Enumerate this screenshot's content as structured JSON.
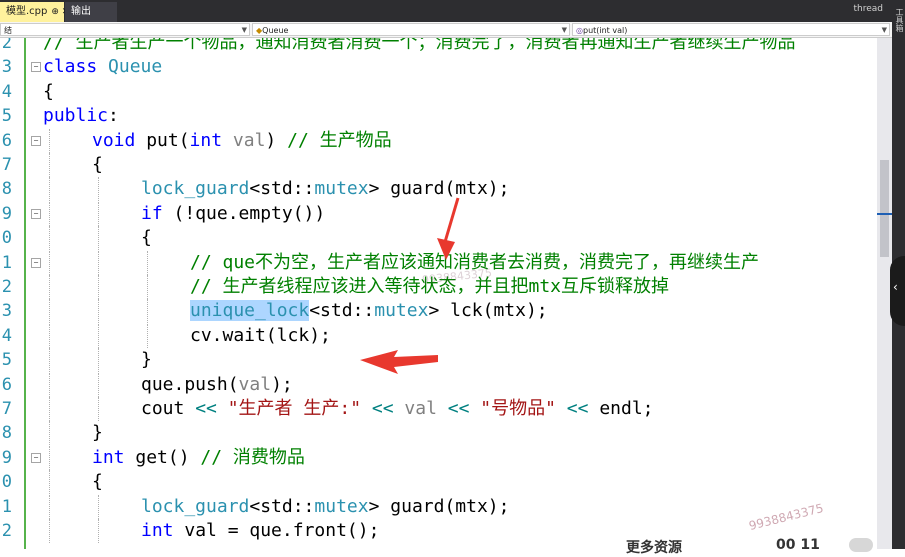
{
  "tabs": [
    {
      "label": "模型.cpp",
      "pin": "⊕ ✕",
      "active": true
    },
    {
      "label": "输出",
      "active": false
    }
  ],
  "tabbar_right": "thread",
  "nav": {
    "scope": "结",
    "class": "Queue",
    "member": "put(int val)"
  },
  "toolstrip_label": "工具箱",
  "code_lines": [
    {
      "num": "2",
      "indent": 0,
      "segments": [
        {
          "t": "// 生产者生产一个物品，通知消费者消费一个；消费完了，消费者再通知生产者继续生产物品",
          "c": "#008000"
        }
      ],
      "fold": ""
    },
    {
      "num": "3",
      "indent": 0,
      "segments": [
        {
          "t": "class ",
          "c": "#0000ff"
        },
        {
          "t": "Queue",
          "c": "#2b91af"
        }
      ],
      "fold": "−"
    },
    {
      "num": "4",
      "indent": 0,
      "segments": [
        {
          "t": "{",
          "c": "#000000"
        }
      ],
      "fold": ""
    },
    {
      "num": "5",
      "indent": 0,
      "segments": [
        {
          "t": "public",
          "c": "#0000ff"
        },
        {
          "t": ":",
          "c": "#000000"
        }
      ],
      "fold": ""
    },
    {
      "num": "6",
      "indent": 1,
      "segments": [
        {
          "t": "void ",
          "c": "#0000ff"
        },
        {
          "t": "put(",
          "c": "#000000"
        },
        {
          "t": "int ",
          "c": "#0000ff"
        },
        {
          "t": "val",
          "c": "#808080"
        },
        {
          "t": ") ",
          "c": "#000000"
        },
        {
          "t": "// 生产物品",
          "c": "#008000"
        }
      ],
      "fold": "−"
    },
    {
      "num": "7",
      "indent": 1,
      "segments": [
        {
          "t": "{",
          "c": "#000000"
        }
      ],
      "fold": ""
    },
    {
      "num": "8",
      "indent": 2,
      "segments": [
        {
          "t": "lock_guard",
          "c": "#2b91af"
        },
        {
          "t": "<std::",
          "c": "#000000"
        },
        {
          "t": "mutex",
          "c": "#2b91af"
        },
        {
          "t": "> guard(mtx);",
          "c": "#000000"
        }
      ],
      "fold": ""
    },
    {
      "num": "9",
      "indent": 2,
      "segments": [
        {
          "t": "if ",
          "c": "#0000ff"
        },
        {
          "t": "(!que.empty())",
          "c": "#000000"
        }
      ],
      "fold": "−"
    },
    {
      "num": "0",
      "indent": 2,
      "segments": [
        {
          "t": "{",
          "c": "#000000"
        }
      ],
      "fold": ""
    },
    {
      "num": "1",
      "indent": 3,
      "segments": [
        {
          "t": "// que不为空，生产者应该通知消费者去消费，消费完了，再继续生产",
          "c": "#008000"
        }
      ],
      "fold": "−"
    },
    {
      "num": "2",
      "indent": 3,
      "segments": [
        {
          "t": "// 生产者线程应该进入等待状态，并且把mtx互斥锁释放掉",
          "c": "#008000"
        }
      ],
      "fold": ""
    },
    {
      "num": "3",
      "indent": 3,
      "segments": [
        {
          "t": "unique_lock",
          "c": "#2b91af",
          "hl": true
        },
        {
          "t": "<std::",
          "c": "#000000"
        },
        {
          "t": "mutex",
          "c": "#2b91af"
        },
        {
          "t": "> lck(mtx);",
          "c": "#000000"
        }
      ],
      "fold": ""
    },
    {
      "num": "4",
      "indent": 3,
      "segments": [
        {
          "t": "cv.wait(lck);",
          "c": "#000000"
        }
      ],
      "fold": ""
    },
    {
      "num": "5",
      "indent": 2,
      "segments": [
        {
          "t": "}",
          "c": "#000000"
        }
      ],
      "fold": ""
    },
    {
      "num": "6",
      "indent": 2,
      "segments": [
        {
          "t": "que.push(",
          "c": "#000000"
        },
        {
          "t": "val",
          "c": "#808080"
        },
        {
          "t": ");",
          "c": "#000000"
        }
      ],
      "fold": ""
    },
    {
      "num": "7",
      "indent": 2,
      "segments": [
        {
          "t": "cout ",
          "c": "#000000"
        },
        {
          "t": "<< ",
          "c": "#008080"
        },
        {
          "t": "\"生产者 生产:\" ",
          "c": "#a31515"
        },
        {
          "t": "<< ",
          "c": "#008080"
        },
        {
          "t": "val ",
          "c": "#808080"
        },
        {
          "t": "<< ",
          "c": "#008080"
        },
        {
          "t": "\"号物品\" ",
          "c": "#a31515"
        },
        {
          "t": "<< ",
          "c": "#008080"
        },
        {
          "t": "endl;",
          "c": "#000000"
        }
      ],
      "fold": ""
    },
    {
      "num": "8",
      "indent": 1,
      "segments": [
        {
          "t": "}",
          "c": "#000000"
        }
      ],
      "fold": ""
    },
    {
      "num": "9",
      "indent": 1,
      "segments": [
        {
          "t": "int ",
          "c": "#0000ff"
        },
        {
          "t": "get() ",
          "c": "#000000"
        },
        {
          "t": "// 消费物品",
          "c": "#008000"
        }
      ],
      "fold": "−"
    },
    {
      "num": "0",
      "indent": 1,
      "segments": [
        {
          "t": "{",
          "c": "#000000"
        }
      ],
      "fold": ""
    },
    {
      "num": "1",
      "indent": 2,
      "segments": [
        {
          "t": "lock_guard",
          "c": "#2b91af"
        },
        {
          "t": "<std::",
          "c": "#000000"
        },
        {
          "t": "mutex",
          "c": "#2b91af"
        },
        {
          "t": "> guard(mtx);",
          "c": "#000000"
        }
      ],
      "fold": ""
    },
    {
      "num": "2",
      "indent": 2,
      "segments": [
        {
          "t": "int ",
          "c": "#0000ff"
        },
        {
          "t": "val = que.front();",
          "c": "#000000"
        }
      ],
      "fold": ""
    }
  ],
  "watermark": "9938843375",
  "footer": {
    "text": "更多资源",
    "num": "00 11"
  }
}
